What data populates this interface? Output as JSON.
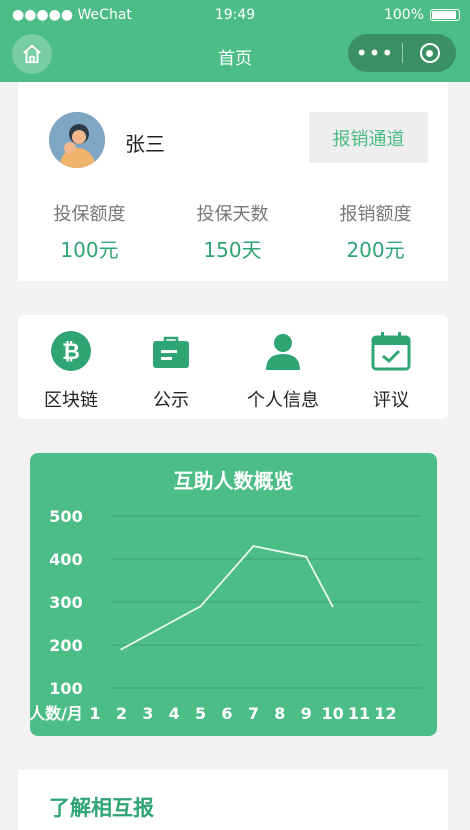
{
  "status": {
    "carrier": "●●●●● WeChat",
    "time": "19:49",
    "battery": "100%"
  },
  "nav": {
    "title": "首页"
  },
  "profile": {
    "name": "张三",
    "claim_button": "报销通道",
    "stats": [
      {
        "label": "投保额度",
        "value": "100元"
      },
      {
        "label": "投保天数",
        "value": "150天"
      },
      {
        "label": "报销额度",
        "value": "200元"
      }
    ]
  },
  "menu": [
    {
      "label": "区块链",
      "icon": "bitcoin-icon"
    },
    {
      "label": "公示",
      "icon": "briefcase-icon"
    },
    {
      "label": "个人信息",
      "icon": "user-icon"
    },
    {
      "label": "评议",
      "icon": "calendar-check-icon"
    }
  ],
  "chart_data": {
    "type": "line",
    "title": "互助人数概览",
    "xlabel": "人数/月",
    "ylabel": "",
    "x": [
      1,
      2,
      3,
      4,
      5,
      6,
      7,
      8,
      9,
      10,
      11,
      12
    ],
    "yticks": [
      100,
      200,
      300,
      400,
      500
    ],
    "ylim": [
      100,
      500
    ],
    "series": [
      {
        "points": [
          [
            2,
            190
          ],
          [
            5,
            290
          ],
          [
            7,
            430
          ],
          [
            9,
            405
          ],
          [
            10,
            290
          ]
        ]
      }
    ],
    "colors": {
      "background": "#4cbd86",
      "line": "#e8f7ee",
      "grid": "#43aa79"
    }
  },
  "about": {
    "title": "了解相互报"
  }
}
